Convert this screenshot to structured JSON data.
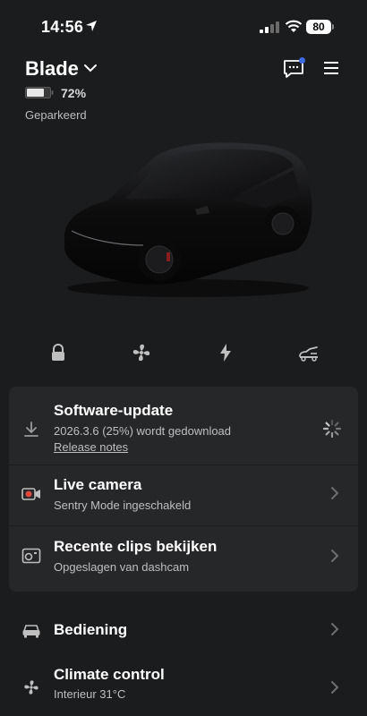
{
  "status_bar": {
    "time": "14:56",
    "battery": "80"
  },
  "header": {
    "vehicle_name": "Blade",
    "battery_percent": "72%",
    "state": "Geparkeerd"
  },
  "quick_controls": [
    "lock-icon",
    "fan-icon",
    "charge-icon",
    "trunk-icon"
  ],
  "software_update": {
    "title": "Software-update",
    "subtitle": "2026.3.6 (25%) wordt gedownload",
    "link": "Release notes"
  },
  "live_camera": {
    "title": "Live camera",
    "subtitle": "Sentry Mode ingeschakeld"
  },
  "recent_clips": {
    "title": "Recente clips bekijken",
    "subtitle": "Opgeslagen van dashcam"
  },
  "controls": {
    "title": "Bediening"
  },
  "climate": {
    "title": "Climate control",
    "subtitle": "Interieur 31°C"
  },
  "colors": {
    "background": "#1b1c1e",
    "card": "#262729",
    "accent_dot": "#3e6ae1",
    "record_red": "#e0483e"
  }
}
